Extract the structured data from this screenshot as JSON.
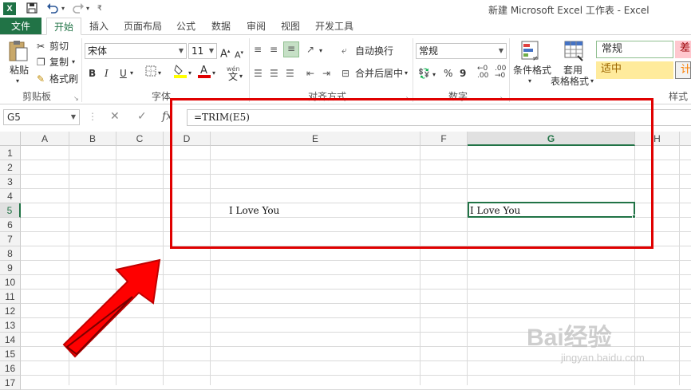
{
  "title": "新建 Microsoft Excel 工作表 - Excel",
  "quick_access": {
    "logo": "X",
    "save_icon": "save-icon",
    "undo_icon": "undo-icon",
    "redo_icon": "redo-icon"
  },
  "tabs": [
    "文件",
    "开始",
    "插入",
    "页面布局",
    "公式",
    "数据",
    "审阅",
    "视图",
    "开发工具"
  ],
  "active_tab": "开始",
  "ribbon": {
    "clipboard": {
      "paste": "粘贴",
      "cut": "剪切",
      "copy": "复制",
      "format_painter": "格式刷",
      "label": "剪贴板"
    },
    "font": {
      "name": "宋体",
      "size": "11",
      "grow": "A",
      "shrink": "A",
      "bold": "B",
      "italic": "I",
      "underline": "U",
      "label": "字体",
      "wen": "wén",
      "wen_sub": "文"
    },
    "alignment": {
      "wrap": "自动换行",
      "merge": "合并后居中",
      "label": "对齐方式"
    },
    "number": {
      "format": "常规",
      "percent": "%",
      "comma": "9",
      "label": "数字"
    },
    "styles": {
      "conditional": "条件格式",
      "table1": "套用",
      "table2": "表格格式",
      "normal": "常规",
      "bad": "差",
      "neutral": "适中",
      "calc": "计",
      "label": "样式"
    }
  },
  "accent_color": "#217346",
  "formula_bar": {
    "name_box": "G5",
    "formula": "=TRIM(E5)",
    "fx": "fx"
  },
  "columns": [
    "A",
    "B",
    "C",
    "D",
    "E",
    "F",
    "G",
    "H"
  ],
  "selected_column": "G",
  "rows": [
    "1",
    "2",
    "3",
    "4",
    "5",
    "6",
    "7",
    "8",
    "9",
    "10",
    "11",
    "12",
    "13",
    "14",
    "15",
    "16",
    "17"
  ],
  "selected_row": "5",
  "cells": {
    "E5": "I Love You",
    "G5": "I Love You"
  },
  "watermark": {
    "brand": "Bai经验",
    "url": "jingyan.baidu.com"
  }
}
